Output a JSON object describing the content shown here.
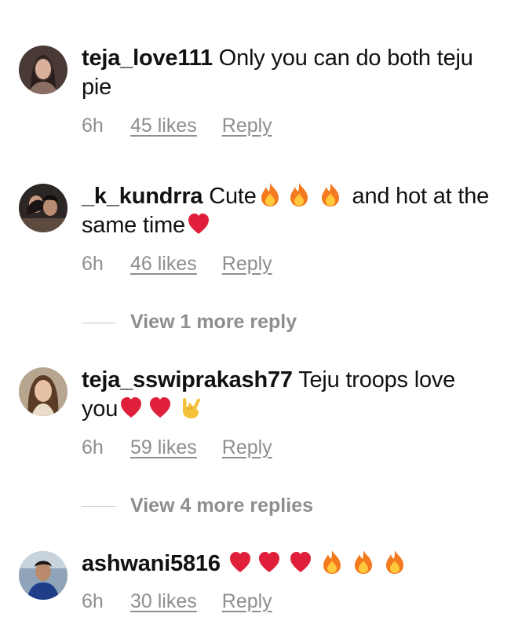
{
  "comments": [
    {
      "username": "teja_love111",
      "text_before": " Only you can do both teju pie",
      "time": "6h",
      "likes": "45 likes",
      "reply": "Reply"
    },
    {
      "username": "_k_kundrra",
      "text_before": " Cute",
      "text_middle": " and hot at the same time",
      "emojis": [
        "fire-emoji",
        "fire-emoji",
        "fire-emoji",
        "red-heart-emoji"
      ],
      "time": "6h",
      "likes": "46 likes",
      "reply": "Reply",
      "view_more": "View 1 more reply"
    },
    {
      "username": "teja_sswiprakash77",
      "text_before": " Teju troops love you",
      "emojis": [
        "red-heart-emoji",
        "red-heart-emoji",
        "rock-on-hand-emoji"
      ],
      "time": "6h",
      "likes": "59 likes",
      "reply": "Reply",
      "view_more": "View 4 more replies"
    },
    {
      "username": "ashwani5816",
      "text_before": " ",
      "emojis": [
        "red-heart-emoji",
        "red-heart-emoji",
        "red-heart-emoji",
        "fire-emoji",
        "fire-emoji",
        "fire-emoji"
      ],
      "time": "6h",
      "likes": "30 likes",
      "reply": "Reply"
    }
  ],
  "colors": {
    "text": "#111111",
    "meta": "#8e8e8e",
    "heart": "#e0203a",
    "fire": "#f47a1f"
  }
}
